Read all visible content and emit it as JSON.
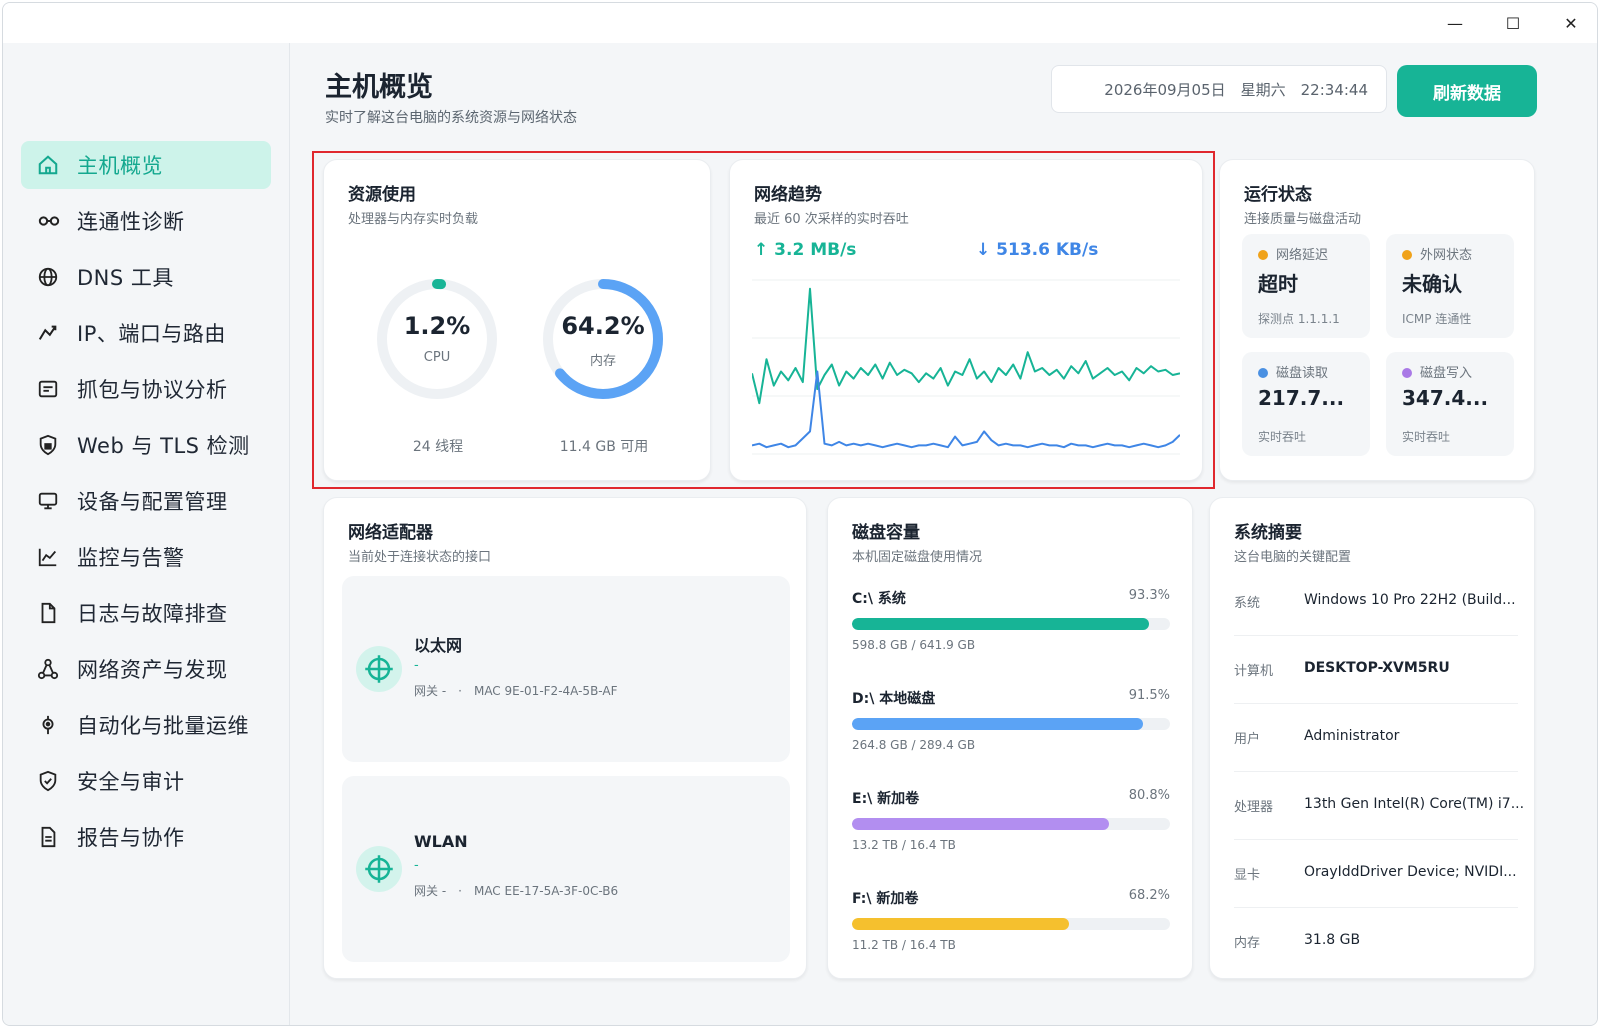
{
  "window": {
    "minimize": "—",
    "maximize": "☐",
    "close": "✕"
  },
  "sidebar": {
    "items": [
      {
        "label": "主机概览",
        "icon": "home-icon",
        "active": true
      },
      {
        "label": "连通性诊断",
        "icon": "link-icon"
      },
      {
        "label": "DNS 工具",
        "icon": "globe-icon"
      },
      {
        "label": "IP、端口与路由",
        "icon": "route-icon"
      },
      {
        "label": "抓包与协议分析",
        "icon": "packet-icon"
      },
      {
        "label": "Web 与 TLS 检测",
        "icon": "shield-lock-icon"
      },
      {
        "label": "设备与配置管理",
        "icon": "monitor-icon"
      },
      {
        "label": "监控与告警",
        "icon": "chart-line-icon"
      },
      {
        "label": "日志与故障排查",
        "icon": "file-icon"
      },
      {
        "label": "网络资产与发现",
        "icon": "network-nodes-icon"
      },
      {
        "label": "自动化与批量运维",
        "icon": "automation-icon"
      },
      {
        "label": "安全与审计",
        "icon": "shield-check-icon"
      },
      {
        "label": "报告与协作",
        "icon": "report-icon"
      }
    ]
  },
  "header": {
    "title": "主机概览",
    "subtitle": "实时了解这台电脑的系统资源与网络状态",
    "datetime": "2026年09月05日　星期六　22:34:44",
    "refresh_label": "刷新数据"
  },
  "resource": {
    "title": "资源使用",
    "subtitle": "处理器与内存实时负载",
    "cpu": {
      "value": "1.2%",
      "label": "CPU",
      "foot": "24 线程",
      "percent": 1.2,
      "color": "#17b496"
    },
    "mem": {
      "value": "64.2%",
      "label": "内存",
      "foot": "11.4 GB 可用",
      "percent": 64.2,
      "color": "#5ba3f5"
    }
  },
  "network_trend": {
    "title": "网络趋势",
    "subtitle": "最近 60 次采样的实时吞吐",
    "up": "↑ 3.2 MB/s",
    "down": "↓ 513.6 KB/s",
    "up_color": "#17b496",
    "down_color": "#3f86e6"
  },
  "chart_data": {
    "type": "line",
    "title": "网络趋势",
    "x": [
      1,
      2,
      3,
      4,
      5,
      6,
      7,
      8,
      9,
      10,
      11,
      12,
      13,
      14,
      15,
      16,
      17,
      18,
      19,
      20,
      21,
      22,
      23,
      24,
      25,
      26,
      27,
      28,
      29,
      30,
      31,
      32,
      33,
      34,
      35,
      36,
      37,
      38,
      39,
      40,
      41,
      42,
      43,
      44,
      45,
      46,
      47,
      48,
      49,
      50,
      51,
      52,
      53,
      54,
      55,
      56,
      57,
      58,
      59,
      60
    ],
    "series": [
      {
        "color": "#17b496",
        "values": [
          47,
          30,
          55,
          40,
          48,
          43,
          50,
          42,
          95,
          38,
          46,
          52,
          40,
          48,
          44,
          50,
          46,
          52,
          44,
          53,
          46,
          49,
          47,
          42,
          47,
          44,
          50,
          40,
          48,
          46,
          55,
          44,
          48,
          42,
          50,
          46,
          52,
          44,
          59,
          48,
          50,
          46,
          49,
          44,
          51,
          47,
          54,
          44,
          47,
          50,
          46,
          48,
          43,
          50,
          47,
          51,
          48,
          49,
          46,
          47
        ]
      },
      {
        "color": "#3f86e6",
        "values": [
          6,
          7,
          5,
          6,
          7,
          5,
          6,
          10,
          14,
          48,
          7,
          6,
          8,
          6,
          7,
          6,
          7,
          6,
          5,
          6,
          7,
          6,
          5,
          6,
          6,
          7,
          6,
          5,
          11,
          6,
          7,
          8,
          14,
          9,
          6,
          7,
          6,
          6,
          5,
          6,
          7,
          6,
          6,
          5,
          7,
          6,
          6,
          5,
          6,
          7,
          6,
          6,
          5,
          6,
          7,
          6,
          5,
          6,
          8,
          12
        ]
      }
    ],
    "ylim": [
      0,
      100
    ]
  },
  "status": {
    "title": "运行状态",
    "subtitle": "连接质量与磁盘活动",
    "tiles": [
      {
        "label": "网络延迟",
        "value": "超时",
        "sub": "探测点 1.1.1.1",
        "dot": "#f0a21a"
      },
      {
        "label": "外网状态",
        "value": "未确认",
        "sub": "ICMP 连通性",
        "dot": "#f0a21a"
      },
      {
        "label": "磁盘读取",
        "value": "217.7...",
        "sub": "实时吞吐",
        "dot": "#4a90e2"
      },
      {
        "label": "磁盘写入",
        "value": "347.4...",
        "sub": "实时吞吐",
        "dot": "#a979e6"
      }
    ]
  },
  "adapters": {
    "title": "网络适配器",
    "subtitle": "当前处于连接状态的接口",
    "items": [
      {
        "name": "以太网",
        "dash": "-",
        "meta": "网关 -　·　MAC 9E-01-F2-4A-5B-AF"
      },
      {
        "name": "WLAN",
        "dash": "-",
        "meta": "网关 -　·　MAC EE-17-5A-3F-0C-B6"
      }
    ]
  },
  "disks": {
    "title": "磁盘容量",
    "subtitle": "本机固定磁盘使用情况",
    "items": [
      {
        "name": "C:\\ 系统",
        "pct": "93.3%",
        "size": "598.8 GB / 641.9 GB",
        "percent": 93.3,
        "color": "#17b496"
      },
      {
        "name": "D:\\ 本地磁盘",
        "pct": "91.5%",
        "size": "264.8 GB / 289.4 GB",
        "percent": 91.5,
        "color": "#5ba3f5"
      },
      {
        "name": "E:\\ 新加卷",
        "pct": "80.8%",
        "size": "13.2 TB / 16.4 TB",
        "percent": 80.8,
        "color": "#b28ef0"
      },
      {
        "name": "F:\\ 新加卷",
        "pct": "68.2%",
        "size": "11.2 TB / 16.4 TB",
        "percent": 68.2,
        "color": "#f5c02e"
      }
    ]
  },
  "summary": {
    "title": "系统摘要",
    "subtitle": "这台电脑的关键配置",
    "rows": [
      {
        "key": "系统",
        "value": "Windows 10 Pro 22H2 (Build..."
      },
      {
        "key": "计算机",
        "value": "DESKTOP-XVM5RU",
        "bold": true
      },
      {
        "key": "用户",
        "value": "Administrator"
      },
      {
        "key": "处理器",
        "value": "13th Gen Intel(R) Core(TM) i7..."
      },
      {
        "key": "显卡",
        "value": "OrayIddDriver Device; NVIDI..."
      },
      {
        "key": "内存",
        "value": "31.8 GB"
      }
    ]
  }
}
